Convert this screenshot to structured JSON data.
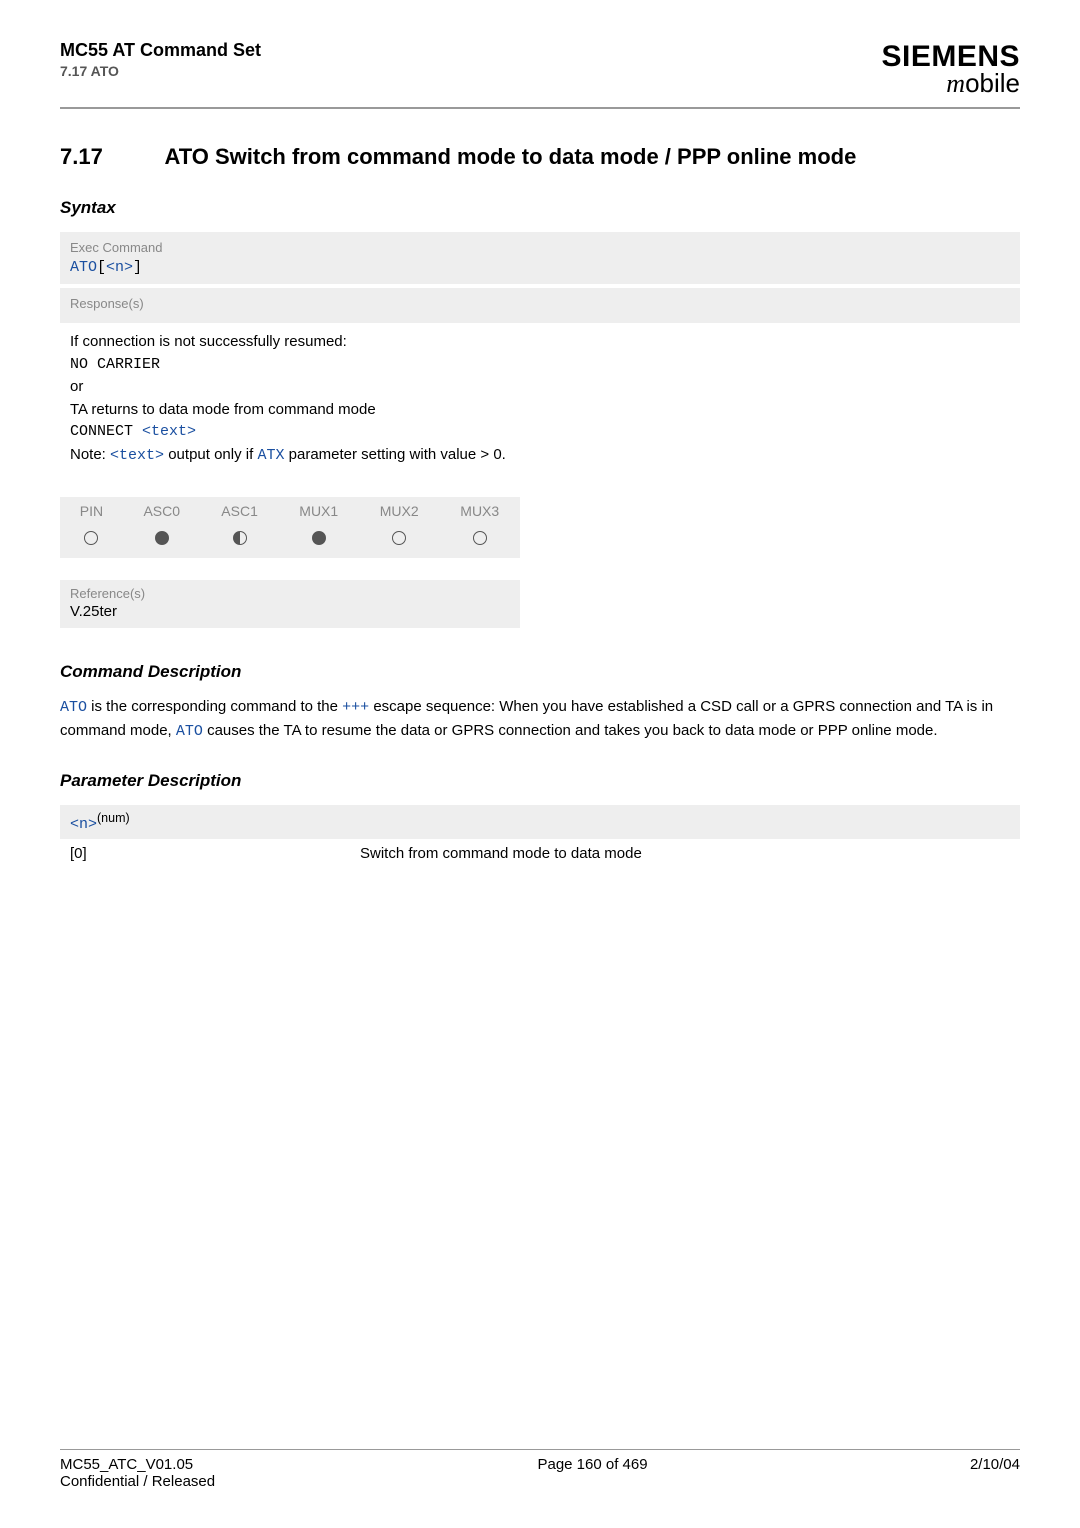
{
  "header": {
    "title": "MC55 AT Command Set",
    "sub": "7.17 ATO",
    "brand": "SIEMENS",
    "brand_sub": "obile"
  },
  "section": {
    "num": "7.17",
    "title": "ATO   Switch from command mode to data mode / PPP online mode"
  },
  "syntax_label": "Syntax",
  "exec": {
    "label": "Exec Command",
    "cmd_pre": "ATO",
    "bracket_open": "[",
    "param": "<n>",
    "bracket_close": "]"
  },
  "response": {
    "label": "Response(s)",
    "line1": "If connection is not successfully resumed:",
    "line2": "NO CARRIER",
    "line3": "or",
    "line4": "TA returns to data mode from command mode",
    "line5_pre": "CONNECT ",
    "line5_param": "<text>",
    "note_pre": "Note: ",
    "note_code1": "<text>",
    "note_mid": " output only if ",
    "note_code2": "ATX",
    "note_post": " parameter setting with value > 0."
  },
  "indicators": {
    "headers": [
      "PIN",
      "ASC0",
      "ASC1",
      "MUX1",
      "MUX2",
      "MUX3"
    ],
    "states": [
      "open",
      "full",
      "half",
      "full",
      "open",
      "open"
    ]
  },
  "reference": {
    "label": "Reference(s)",
    "value": "V.25ter"
  },
  "cmd_desc": {
    "heading": "Command Description",
    "p1_a": " is the corresponding command to the ",
    "p1_b": " escape sequence: When you have established a CSD call or a GPRS connection and TA is in command mode, ",
    "p1_c": " causes the TA to resume the data or GPRS connection and takes you back to data mode or PPP online mode.",
    "code_ato": "ATO",
    "code_plus": "+++"
  },
  "param_desc": {
    "heading": "Parameter Description",
    "param": "<n>",
    "sup": "(num)",
    "key": "[0]",
    "val": "Switch from command mode to data mode"
  },
  "footer": {
    "left1": "MC55_ATC_V01.05",
    "left2": "Confidential / Released",
    "center": "Page 160 of 469",
    "right": "2/10/04"
  }
}
